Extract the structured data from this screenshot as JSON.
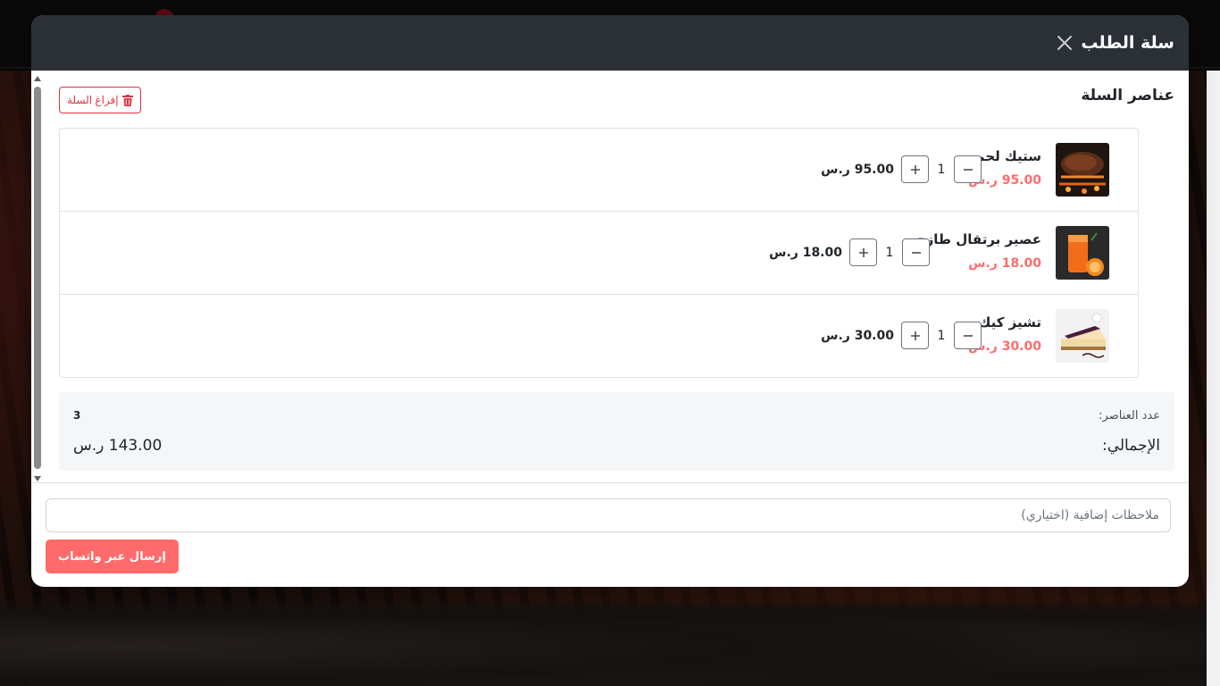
{
  "modal": {
    "title": "سلة الطلب",
    "section_title": "عناصر السلة",
    "clear_label": "إفراغ السلة"
  },
  "items": [
    {
      "name": "ستيك لحم",
      "unit_price": "95.00 ر.س",
      "qty": "1",
      "line_total": "95.00 ر.س"
    },
    {
      "name": "عصير برتقال طازج",
      "unit_price": "18.00 ر.س",
      "qty": "1",
      "line_total": "18.00 ر.س"
    },
    {
      "name": "تشيز كيك",
      "unit_price": "30.00 ر.س",
      "qty": "1",
      "line_total": "30.00 ر.س"
    }
  ],
  "summary": {
    "count_label": "عدد العناصر:",
    "count_value": "3",
    "total_label": "الإجمالي:",
    "total_value": "143.00 ر.س"
  },
  "footer": {
    "notes_placeholder": "ملاحظات إضافية (اختياري)",
    "notes_value": "",
    "send_label": "إرسال عبر واتساب"
  },
  "colors": {
    "header_bg": "#2b3037",
    "accent": "#ff6b6b",
    "danger": "#dc3545"
  }
}
